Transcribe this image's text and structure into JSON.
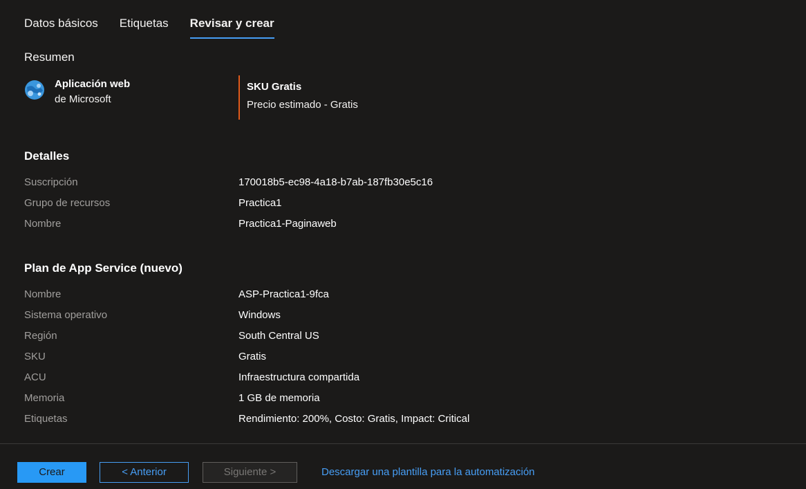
{
  "tabs": [
    {
      "label": "Datos básicos",
      "active": false
    },
    {
      "label": "Etiquetas",
      "active": false
    },
    {
      "label": "Revisar y crear",
      "active": true
    }
  ],
  "summary": {
    "label": "Resumen",
    "app_name": "Aplicación web",
    "publisher": "de Microsoft",
    "app_icon": "globe-icon",
    "sku_title": "SKU Gratis",
    "sku_price": "Precio estimado - Gratis"
  },
  "details": {
    "heading": "Detalles",
    "rows": [
      {
        "label": "Suscripción",
        "value": "170018b5-ec98-4a18-b7ab-187fb30e5c16"
      },
      {
        "label": "Grupo de recursos",
        "value": "Practica1"
      },
      {
        "label": "Nombre",
        "value": "Practica1-Paginaweb"
      }
    ]
  },
  "plan": {
    "heading": "Plan de App Service (nuevo)",
    "rows": [
      {
        "label": "Nombre",
        "value": "ASP-Practica1-9fca"
      },
      {
        "label": "Sistema operativo",
        "value": "Windows"
      },
      {
        "label": "Región",
        "value": "South Central US"
      },
      {
        "label": "SKU",
        "value": "Gratis"
      },
      {
        "label": "ACU",
        "value": "Infraestructura compartida"
      },
      {
        "label": "Memoria",
        "value": "1 GB de memoria"
      },
      {
        "label": "Etiquetas",
        "value": "Rendimiento: 200%, Costo: Gratis, Impact: Critical"
      }
    ]
  },
  "footer": {
    "create": "Crear",
    "previous": "< Anterior",
    "next": "Siguiente >",
    "download_link": "Descargar una plantilla para la automatización"
  },
  "colors": {
    "background": "#1b1a19",
    "accent": "#2899f5",
    "link": "#479ef5",
    "sku_border": "#e05a1a"
  }
}
